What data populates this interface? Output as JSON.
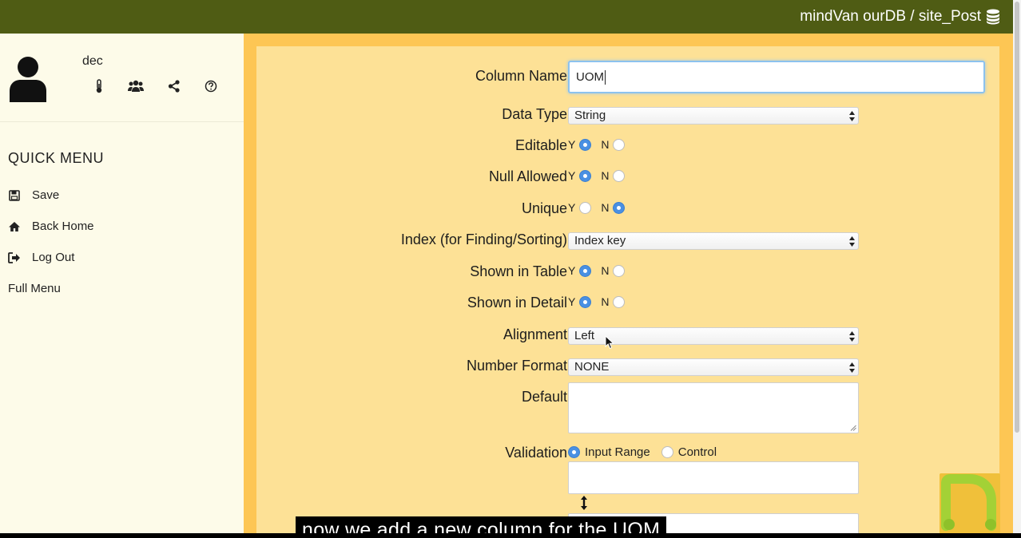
{
  "topbar": {
    "brand": "mindVan ourDB / site_Post",
    "icon": "database-icon"
  },
  "sidebar": {
    "username": "dec",
    "tools": [
      {
        "name": "thermometer-icon"
      },
      {
        "name": "users-icon"
      },
      {
        "name": "share-icon"
      },
      {
        "name": "help-icon"
      }
    ],
    "quick_menu_title": "QUICK MENU",
    "menu": [
      {
        "icon": "save-icon",
        "label": "Save"
      },
      {
        "icon": "home-icon",
        "label": "Back Home"
      },
      {
        "icon": "logout-icon",
        "label": "Log Out"
      }
    ],
    "full_menu": "Full Menu"
  },
  "form": {
    "column_name": {
      "label": "Column Name",
      "value": "UOM"
    },
    "data_type": {
      "label": "Data Type",
      "value": "String"
    },
    "editable": {
      "label": "Editable",
      "yes": "Y",
      "no": "N",
      "selected": "Y"
    },
    "null_allowed": {
      "label": "Null Allowed",
      "yes": "Y",
      "no": "N",
      "selected": "Y"
    },
    "unique": {
      "label": "Unique",
      "yes": "Y",
      "no": "N",
      "selected": "N"
    },
    "index": {
      "label": "Index (for Finding/Sorting)",
      "value": "Index key"
    },
    "shown_in_table": {
      "label": "Shown in Table",
      "yes": "Y",
      "no": "N",
      "selected": "Y"
    },
    "shown_in_detail": {
      "label": "Shown in Detail",
      "yes": "Y",
      "no": "N",
      "selected": "Y"
    },
    "alignment": {
      "label": "Alignment",
      "value": "Left"
    },
    "number_format": {
      "label": "Number Format",
      "value": "NONE"
    },
    "default": {
      "label": "Default",
      "value": ""
    },
    "validation": {
      "label": "Validation",
      "option_range": "Input Range",
      "option_control": "Control",
      "selected": "Input Range"
    }
  },
  "subtitle": "now we add a new column for the UOM",
  "colors": {
    "topbar": "#4f5c14",
    "main": "#fdc654",
    "panel": "#fde196",
    "sidebar": "#fdfbe9",
    "radio_on": "#4a90e2"
  }
}
